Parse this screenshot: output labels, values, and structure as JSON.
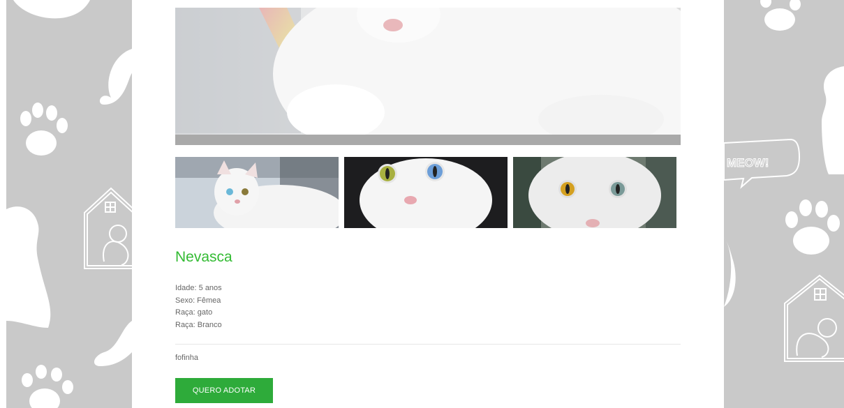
{
  "pet": {
    "name": "Nevasca",
    "details": [
      "Idade: 5 anos",
      "Sexo: Fêmea",
      "Raça: gato",
      "Raça: Branco"
    ],
    "description": "fofinha"
  },
  "actions": {
    "adopt_label": "QUERO ADOTAR"
  },
  "decor": {
    "speech_bubble_text": "MEOW!"
  },
  "colors": {
    "accent": "#2eab3a",
    "name_green": "#33bb33",
    "side_bg": "#c9c9c9"
  },
  "icons": [
    "paw-icon",
    "dog-silhouette-icon",
    "cat-house-icon",
    "speech-bubble-icon"
  ]
}
